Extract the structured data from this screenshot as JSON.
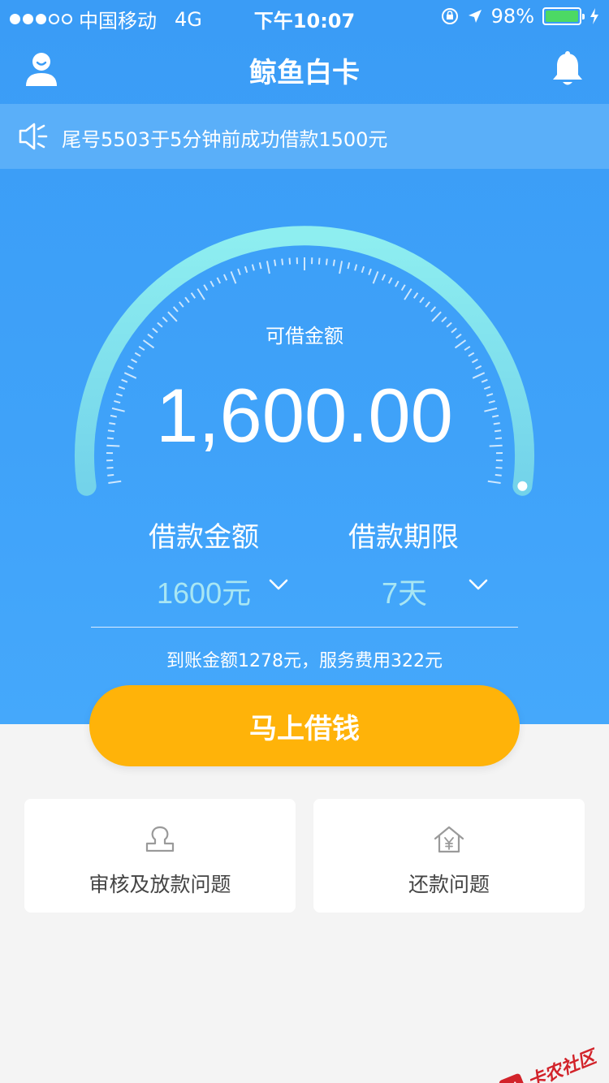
{
  "status_bar": {
    "carrier": "中国移动",
    "network": "4G",
    "time": "下午10:07",
    "battery_percent": "98%",
    "battery_level": 0.98,
    "signal_bars": 3,
    "signal_total": 5
  },
  "nav": {
    "title": "鲸鱼白卡",
    "user_icon": "user-avatar-icon",
    "bell_icon": "bell-icon"
  },
  "notice": {
    "icon": "speaker-icon",
    "text": "尾号5503于5分钟前成功借款1500元"
  },
  "gauge": {
    "label": "可借金额",
    "amount": "1,600.00",
    "arc_gradient": [
      "#8eeef0",
      "#73d3ea"
    ]
  },
  "loan": {
    "amount_title": "借款金额",
    "amount_value": "1600元",
    "term_title": "借款期限",
    "term_value": "7天",
    "fee_text": "到账金额1278元，服务费用322元"
  },
  "cta": {
    "label": "马上借钱",
    "color": "#ffb309"
  },
  "cards": [
    {
      "label": "审核及放款问题",
      "icon": "stamp-icon"
    },
    {
      "label": "还款问题",
      "icon": "yuan-house-icon"
    }
  ],
  "watermark": {
    "text": "卡农社区"
  },
  "colors": {
    "brand_blue": "#3a9cf6",
    "notice_bar": "#5aaff9",
    "selector_value": "#a8e6f3"
  }
}
